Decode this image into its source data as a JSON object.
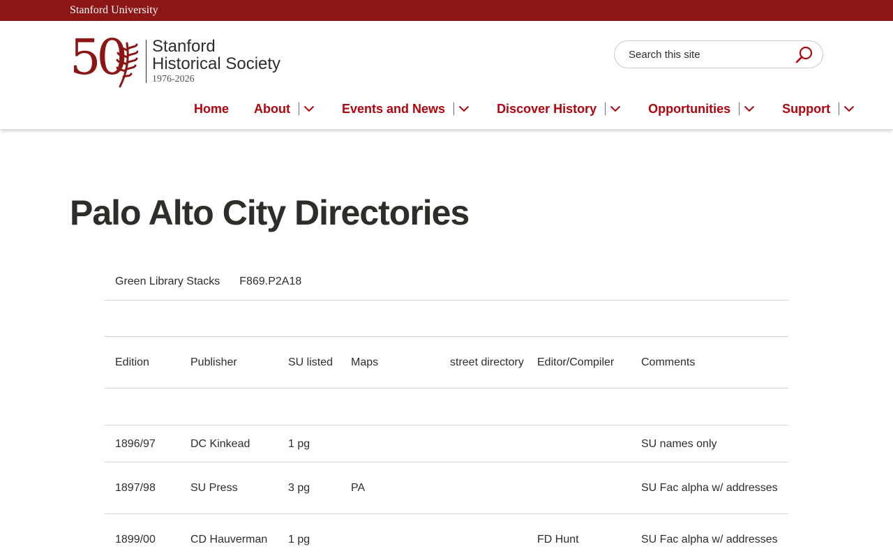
{
  "topbar": {
    "university": "Stanford University"
  },
  "logo": {
    "number": "50",
    "line1": "Stanford",
    "line2": "Historical Society",
    "years": "1976-2026",
    "color": "#8c1515"
  },
  "search": {
    "placeholder": "Search this site",
    "icon": "search-icon"
  },
  "nav": {
    "items": [
      {
        "label": "Home"
      },
      {
        "label": "About"
      },
      {
        "label": "Events and News"
      },
      {
        "label": "Discover History"
      },
      {
        "label": "Opportunities"
      },
      {
        "label": "Support"
      }
    ],
    "color": "#b1040e"
  },
  "page": {
    "title": "Palo Alto City Directories"
  },
  "location": {
    "library": "Green Library Stacks",
    "callnumber": "F869.P2A18"
  },
  "table": {
    "headers": [
      "Edition",
      "Publisher",
      "SU listed",
      "Maps",
      "street directory",
      "Editor/Compiler",
      "Comments"
    ],
    "rows": [
      [
        "1896/97",
        "DC Kinkead",
        "1 pg",
        "",
        "",
        "",
        "SU names only"
      ],
      [
        "1897/98",
        "SU Press",
        "3 pg",
        "PA",
        "",
        "",
        "SU Fac alpha w/ addresses"
      ],
      [
        "1899/00",
        "CD Hauverman",
        "1 pg",
        "",
        "",
        "FD Hunt",
        "SU Fac alpha w/ addresses"
      ]
    ]
  },
  "colors": {
    "brand": "#8c1515",
    "text": "#2e2d29",
    "rule": "#d5d5d4"
  }
}
